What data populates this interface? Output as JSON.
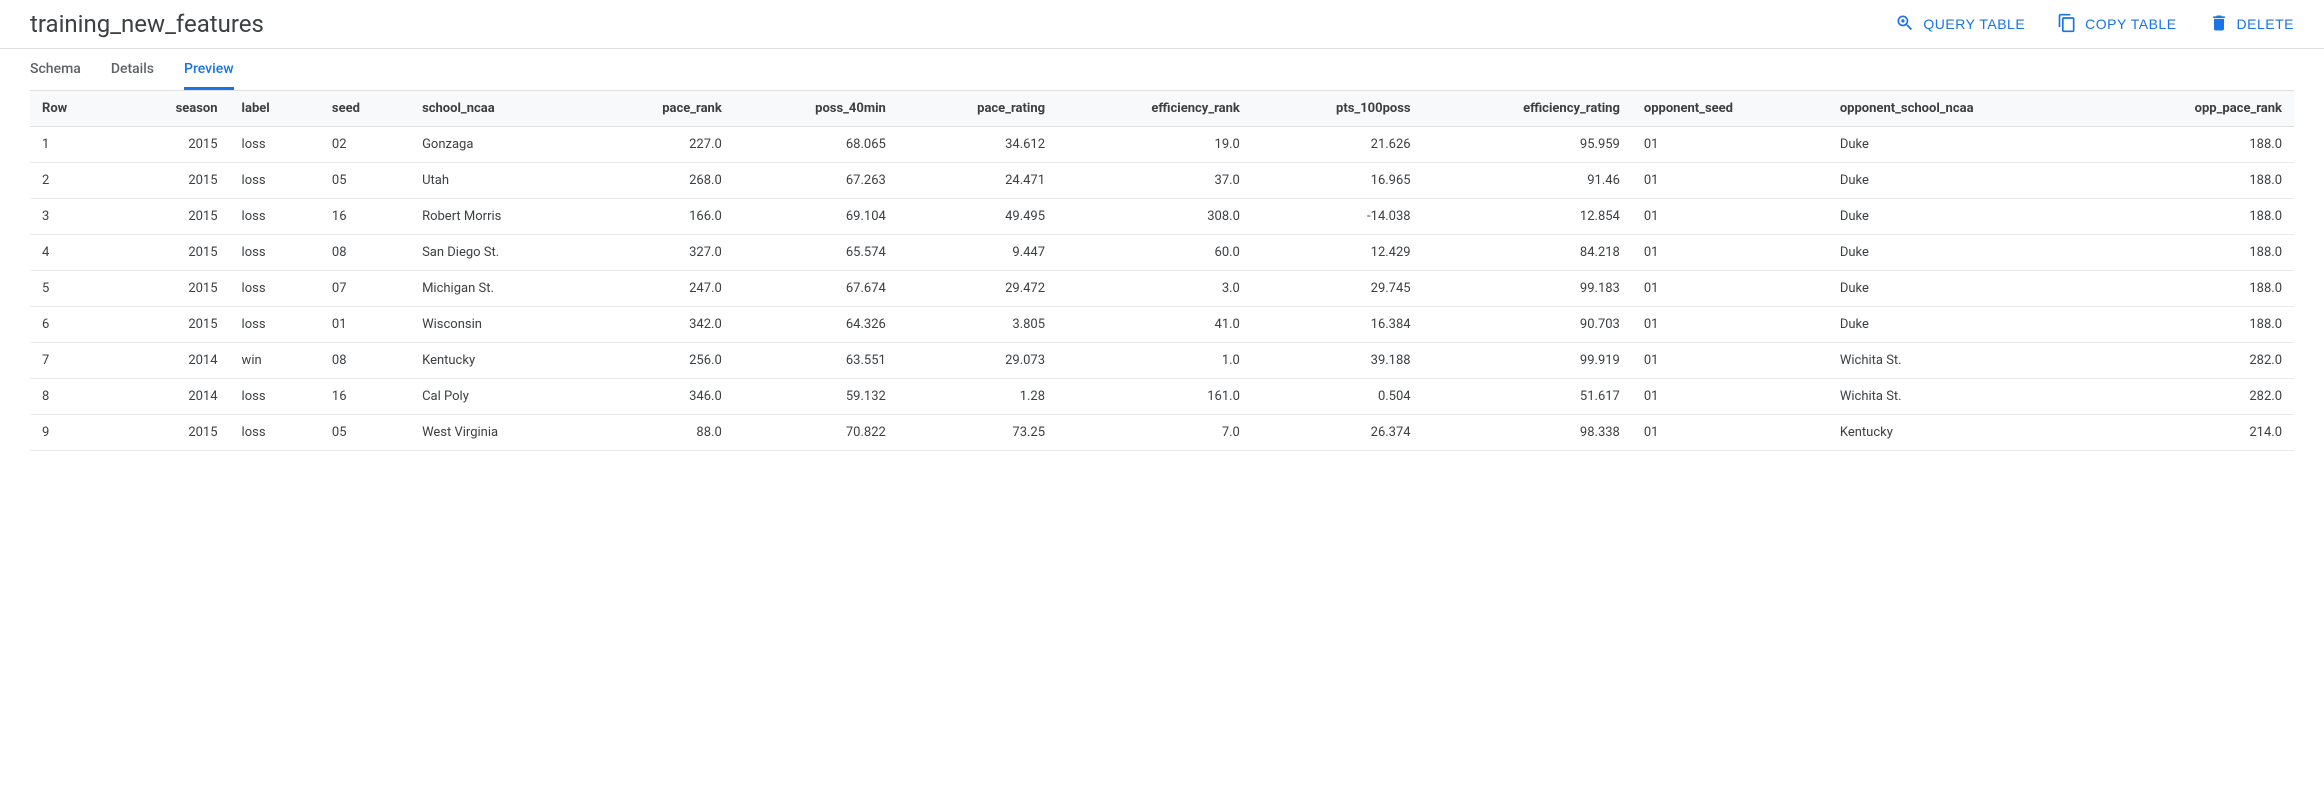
{
  "header": {
    "title": "training_new_features",
    "actions": {
      "query": "QUERY TABLE",
      "copy": "COPY TABLE",
      "delete": "DELETE"
    }
  },
  "tabs": {
    "schema": "Schema",
    "details": "Details",
    "preview": "Preview"
  },
  "table": {
    "columns": [
      "Row",
      "season",
      "label",
      "seed",
      "school_ncaa",
      "pace_rank",
      "poss_40min",
      "pace_rating",
      "efficiency_rank",
      "pts_100poss",
      "efficiency_rating",
      "opponent_seed",
      "opponent_school_ncaa",
      "opp_pace_rank"
    ],
    "align": [
      "txt",
      "num",
      "txt",
      "txt",
      "txt",
      "num",
      "num",
      "num",
      "num",
      "num",
      "num",
      "txt",
      "txt",
      "num"
    ],
    "rows": [
      [
        "1",
        "2015",
        "loss",
        "02",
        "Gonzaga",
        "227.0",
        "68.065",
        "34.612",
        "19.0",
        "21.626",
        "95.959",
        "01",
        "Duke",
        "188.0"
      ],
      [
        "2",
        "2015",
        "loss",
        "05",
        "Utah",
        "268.0",
        "67.263",
        "24.471",
        "37.0",
        "16.965",
        "91.46",
        "01",
        "Duke",
        "188.0"
      ],
      [
        "3",
        "2015",
        "loss",
        "16",
        "Robert Morris",
        "166.0",
        "69.104",
        "49.495",
        "308.0",
        "-14.038",
        "12.854",
        "01",
        "Duke",
        "188.0"
      ],
      [
        "4",
        "2015",
        "loss",
        "08",
        "San Diego St.",
        "327.0",
        "65.574",
        "9.447",
        "60.0",
        "12.429",
        "84.218",
        "01",
        "Duke",
        "188.0"
      ],
      [
        "5",
        "2015",
        "loss",
        "07",
        "Michigan St.",
        "247.0",
        "67.674",
        "29.472",
        "3.0",
        "29.745",
        "99.183",
        "01",
        "Duke",
        "188.0"
      ],
      [
        "6",
        "2015",
        "loss",
        "01",
        "Wisconsin",
        "342.0",
        "64.326",
        "3.805",
        "41.0",
        "16.384",
        "90.703",
        "01",
        "Duke",
        "188.0"
      ],
      [
        "7",
        "2014",
        "win",
        "08",
        "Kentucky",
        "256.0",
        "63.551",
        "29.073",
        "1.0",
        "39.188",
        "99.919",
        "01",
        "Wichita St.",
        "282.0"
      ],
      [
        "8",
        "2014",
        "loss",
        "16",
        "Cal Poly",
        "346.0",
        "59.132",
        "1.28",
        "161.0",
        "0.504",
        "51.617",
        "01",
        "Wichita St.",
        "282.0"
      ],
      [
        "9",
        "2015",
        "loss",
        "05",
        "West Virginia",
        "88.0",
        "70.822",
        "73.25",
        "7.0",
        "26.374",
        "98.338",
        "01",
        "Kentucky",
        "214.0"
      ]
    ]
  }
}
